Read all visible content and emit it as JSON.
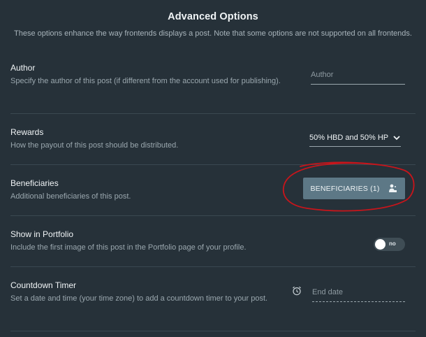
{
  "header": {
    "title": "Advanced Options",
    "subtitle": "These options enhance the way frontends displays a post. Note that some options are not supported on all frontends."
  },
  "author": {
    "label": "Author",
    "description": "Specify the author of this post (if different from the account used for publishing).",
    "placeholder": "Author",
    "value": ""
  },
  "rewards": {
    "label": "Rewards",
    "description": "How the payout of this post should be distributed.",
    "selected": "50% HBD and 50% HP"
  },
  "beneficiaries": {
    "label": "Beneficiaries",
    "description": "Additional beneficiaries of this post.",
    "button_label": "BENEFICIARIES (1)",
    "icon": "beneficiaries-icon"
  },
  "portfolio": {
    "label": "Show in Portfolio",
    "description": "Include the first image of this post in the Portfolio page of your profile.",
    "toggle_text": "no",
    "toggle_on": false
  },
  "countdown": {
    "label": "Countdown Timer",
    "description": "Set a date and time (your time zone) to add a countdown timer to your post.",
    "placeholder": "End date",
    "icon": "alarm-clock-icon"
  },
  "colors": {
    "background": "#263139",
    "button": "#5d7886",
    "annotation_circle": "#c8151b"
  }
}
